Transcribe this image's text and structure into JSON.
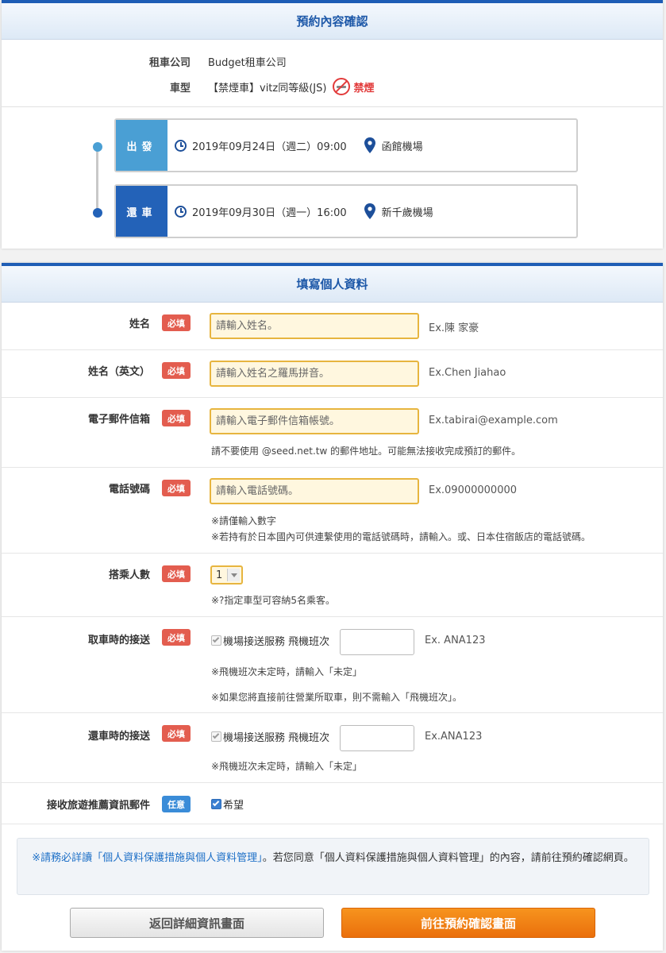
{
  "summary": {
    "title": "預約內容確認",
    "company_label": "租車公司",
    "company_value": "Budget租車公司",
    "car_label": "車型",
    "car_value": "【禁煙車】vitz同等級(JS)",
    "nosmoke_text": "禁煙",
    "departure": {
      "tag": "出發",
      "datetime": "2019年09月24日（週二）09:00",
      "place": "函館機場"
    },
    "return": {
      "tag": "還車",
      "datetime": "2019年09月30日（週一）16:00",
      "place": "新千歲機場"
    }
  },
  "form": {
    "title": "填寫個人資料",
    "required_badge": "必填",
    "optional_badge": "任意",
    "name": {
      "label": "姓名",
      "placeholder": "請輸入姓名。",
      "example": "Ex.陳 家豪"
    },
    "name_en": {
      "label": "姓名（英文）",
      "placeholder": "請輸入姓名之羅馬拼音。",
      "example": "Ex.Chen Jiahao"
    },
    "email": {
      "label": "電子郵件信箱",
      "placeholder": "請輸入電子郵件信箱帳號。",
      "example": "Ex.tabirai@example.com",
      "note": "請不要使用 @seed.net.tw 的郵件地址。可能無法接收完成預訂的郵件。"
    },
    "phone": {
      "label": "電話號碼",
      "placeholder": "請輸入電話號碼。",
      "example": "Ex.09000000000",
      "note1": "※請僅輸入數字",
      "note2": "※若持有於日本國內可供連繫使用的電話號碼時，請輸入。或、日本住宿飯店的電話號碼。"
    },
    "passengers": {
      "label": "搭乘人數",
      "value": "1",
      "note": "※?指定車型可容納5名乘客。"
    },
    "pickup": {
      "label": "取車時的接送",
      "service": "機場接送服務 飛機班次",
      "example": "Ex. ANA123",
      "note1": "※飛機班次未定時，請輸入「未定」",
      "note2": "※如果您將直接前往營業所取車，則不需輸入「飛機班次」。"
    },
    "dropoff": {
      "label": "還車時的接送",
      "service": "機場接送服務 飛機班次",
      "example": "Ex.ANA123",
      "note": "※飛機班次未定時，請輸入「未定」"
    },
    "newsletter": {
      "label": "接收旅遊推薦資訊郵件",
      "option": "希望"
    }
  },
  "notice": {
    "link_text": "※請務必詳讀「個人資料保護措施與個人資料管理」",
    "text": "。若您同意「個人資料保護措施與個人資料管理」的內容，請前往預約確認網頁。"
  },
  "buttons": {
    "back": "返回詳細資訊畫面",
    "next": "前往預約確認畫面"
  },
  "colors": {
    "accent": "#1e5db5",
    "departure": "#4a9fd4",
    "return": "#2362b8",
    "required": "#e35d4f",
    "optional": "#3a8cd8",
    "primary_button": "#f08418"
  }
}
